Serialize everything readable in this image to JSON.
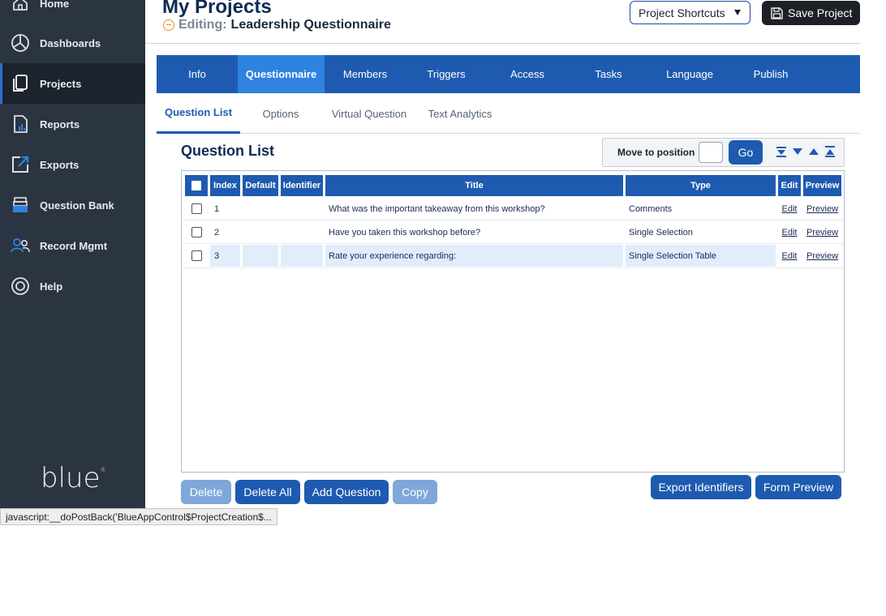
{
  "sidebar": {
    "items": [
      {
        "label": "Home",
        "icon": "home-icon"
      },
      {
        "label": "Dashboards",
        "icon": "dashboard-icon"
      },
      {
        "label": "Projects",
        "icon": "projects-icon",
        "active": true
      },
      {
        "label": "Reports",
        "icon": "reports-icon"
      },
      {
        "label": "Exports",
        "icon": "export-icon"
      },
      {
        "label": "Question Bank",
        "icon": "question-bank-icon"
      },
      {
        "label": "Record Mgmt",
        "icon": "record-mgmt-icon"
      },
      {
        "label": "Help",
        "icon": "help-icon"
      }
    ],
    "logo_text": "blue",
    "logo_mark": "®"
  },
  "header": {
    "title": "My Projects",
    "editing_label": "Editing:",
    "editing_name": "Leadership Questionnaire",
    "shortcuts_label": "Project Shortcuts",
    "save_label": "Save Project"
  },
  "main_tabs": [
    {
      "label": "Info"
    },
    {
      "label": "Questionnaire",
      "active": true
    },
    {
      "label": "Members"
    },
    {
      "label": "Triggers"
    },
    {
      "label": "Access"
    },
    {
      "label": "Tasks"
    },
    {
      "label": "Language"
    },
    {
      "label": "Publish"
    }
  ],
  "sub_tabs": [
    {
      "label": "Question List",
      "active": true
    },
    {
      "label": "Options"
    },
    {
      "label": "Virtual Question"
    },
    {
      "label": "Text Analytics"
    }
  ],
  "question_list": {
    "title": "Question List",
    "move_label": "Move to position",
    "move_value": "",
    "go_label": "Go",
    "columns": [
      "Index",
      "Default",
      "Identifier",
      "Title",
      "Type",
      "Edit",
      "Preview"
    ],
    "rows": [
      {
        "index": "1",
        "default": "",
        "identifier": "",
        "title": "What was the important takeaway from this workshop?",
        "type": "Comments",
        "edit": "Edit",
        "preview": "Preview"
      },
      {
        "index": "2",
        "default": "",
        "identifier": "",
        "title": "Have you taken this workshop before?",
        "type": "Single Selection",
        "edit": "Edit",
        "preview": "Preview"
      },
      {
        "index": "3",
        "default": "",
        "identifier": "",
        "title": "Rate your experience regarding:",
        "type": "Single Selection Table",
        "edit": "Edit",
        "preview": "Preview"
      }
    ]
  },
  "buttons": {
    "delete": "Delete",
    "delete_all": "Delete All",
    "add_question": "Add Question",
    "copy": "Copy",
    "export_identifiers": "Export Identifiers",
    "form_preview": "Form Preview"
  },
  "status_bar": "javascript:__doPostBack('BlueAppControl$ProjectCreation$...",
  "colors": {
    "sidebar_bg": "#2b3542",
    "primary": "#1e5bb0",
    "active_tab": "#2f82e0",
    "disabled_button": "#7fa7d9",
    "editing_accent": "#e0952a"
  }
}
